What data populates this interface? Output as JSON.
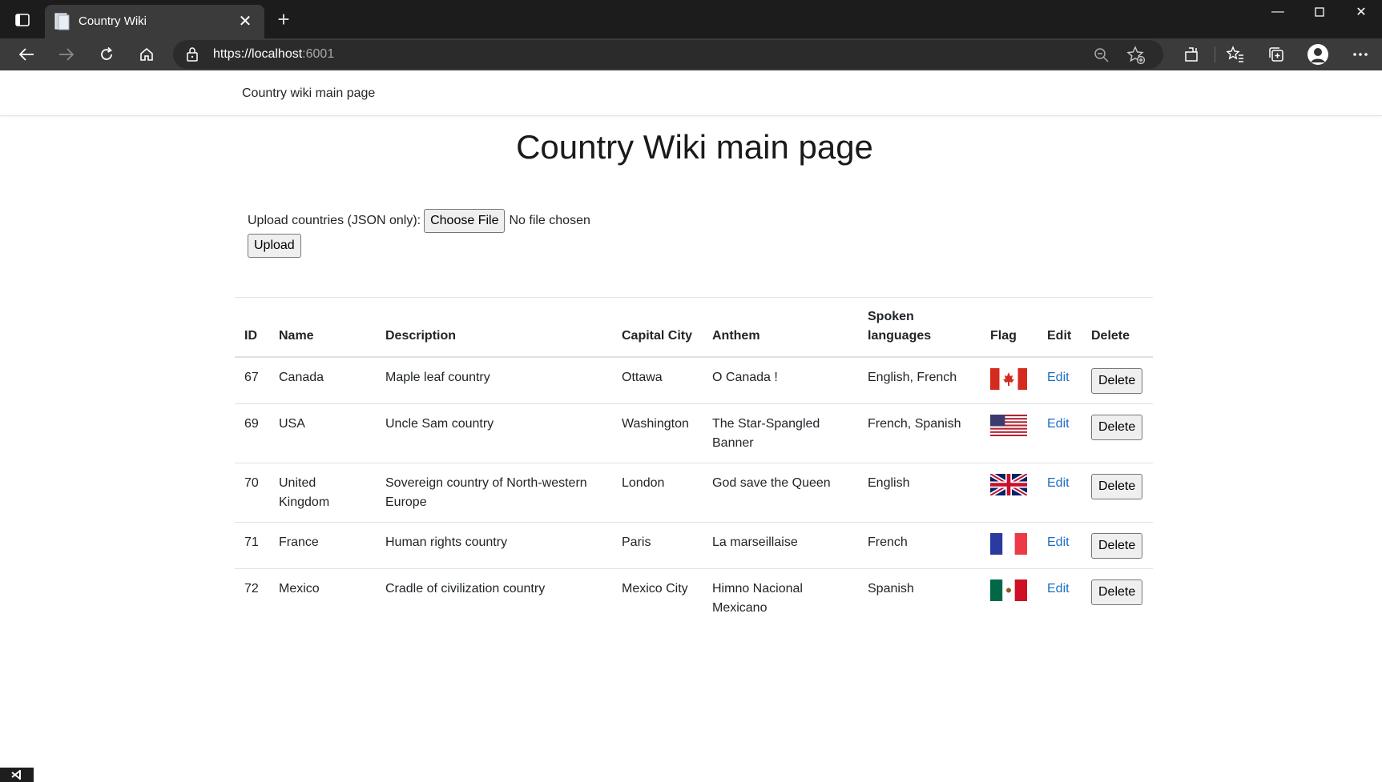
{
  "browser": {
    "tab_title": "Country Wiki",
    "url_main": "https://localhost",
    "url_port": ":6001",
    "icons": [
      "tab-actions-icon",
      "page-favicon",
      "close-icon",
      "plus-icon",
      "minimize-icon",
      "maximize-icon",
      "window-close-icon",
      "back-icon",
      "forward-icon",
      "refresh-icon",
      "home-icon",
      "lock-icon",
      "zoom-icon",
      "add-favorite-icon",
      "extensions-icon",
      "favorites-icon",
      "collections-icon",
      "profile-icon",
      "more-icon"
    ]
  },
  "nav": {
    "brand": "Country wiki main page"
  },
  "page": {
    "title": "Country Wiki main page",
    "upload_label": "Upload countries (JSON only):",
    "choose_file_label": "Choose File",
    "no_file_text": "No file chosen",
    "upload_button": "Upload"
  },
  "table": {
    "headers": {
      "id": "ID",
      "name": "Name",
      "description": "Description",
      "capital": "Capital City",
      "anthem": "Anthem",
      "languages": "Spoken languages",
      "flag": "Flag",
      "edit": "Edit",
      "delete": "Delete"
    },
    "rows": [
      {
        "id": "67",
        "name": "Canada",
        "description": "Maple leaf country",
        "capital": "Ottawa",
        "anthem": "O Canada !",
        "languages": "English, French",
        "flag": "canada-flag",
        "edit": "Edit",
        "delete": "Delete"
      },
      {
        "id": "69",
        "name": "USA",
        "description": "Uncle Sam country",
        "capital": "Washington",
        "anthem": "The Star-Spangled Banner",
        "languages": "French, Spanish",
        "flag": "usa-flag",
        "edit": "Edit",
        "delete": "Delete"
      },
      {
        "id": "70",
        "name": "United Kingdom",
        "description": "Sovereign country of North-western Europe",
        "capital": "London",
        "anthem": "God save the Queen",
        "languages": "English",
        "flag": "uk-flag",
        "edit": "Edit",
        "delete": "Delete"
      },
      {
        "id": "71",
        "name": "France",
        "description": "Human rights country",
        "capital": "Paris",
        "anthem": "La marseillaise",
        "languages": "French",
        "flag": "france-flag",
        "edit": "Edit",
        "delete": "Delete"
      },
      {
        "id": "72",
        "name": "Mexico",
        "description": "Cradle of civilization country",
        "capital": "Mexico City",
        "anthem": "Himno Nacional Mexicano",
        "languages": "Spanish",
        "flag": "mexico-flag",
        "edit": "Edit",
        "delete": "Delete"
      }
    ]
  },
  "colors": {
    "link": "#1b6ec2",
    "chrome_dark": "#1c1c1c",
    "toolbar": "#3b3b3b",
    "border": "#dee2e6"
  }
}
